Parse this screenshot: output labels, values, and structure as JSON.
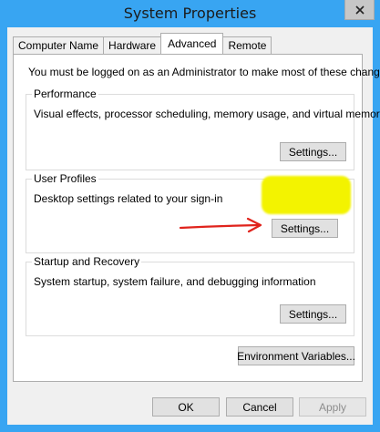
{
  "window": {
    "title": "System Properties"
  },
  "tabs": [
    {
      "label": "Computer Name"
    },
    {
      "label": "Hardware"
    },
    {
      "label": "Advanced",
      "active": true
    },
    {
      "label": "Remote"
    }
  ],
  "notice": "You must be logged on as an Administrator to make most of these changes.",
  "performance": {
    "label": "Performance",
    "description": "Visual effects, processor scheduling, memory usage, and virtual memory",
    "button": "Settings..."
  },
  "user_profiles": {
    "label": "User Profiles",
    "description": "Desktop settings related to your sign-in",
    "button": "Settings..."
  },
  "startup_recovery": {
    "label": "Startup and Recovery",
    "description": "System startup, system failure, and debugging information",
    "button": "Settings..."
  },
  "env_vars_button": "Environment Variables...",
  "footer": {
    "ok": "OK",
    "cancel": "Cancel",
    "apply": "Apply"
  },
  "colors": {
    "titlebar": "#38a5f2",
    "dialog": "#f0f0f0",
    "highlight": "#f3f300",
    "arrow": "#e0231c"
  },
  "icons": {
    "close": "close-icon",
    "annotation": "red-arrow-annotation"
  }
}
